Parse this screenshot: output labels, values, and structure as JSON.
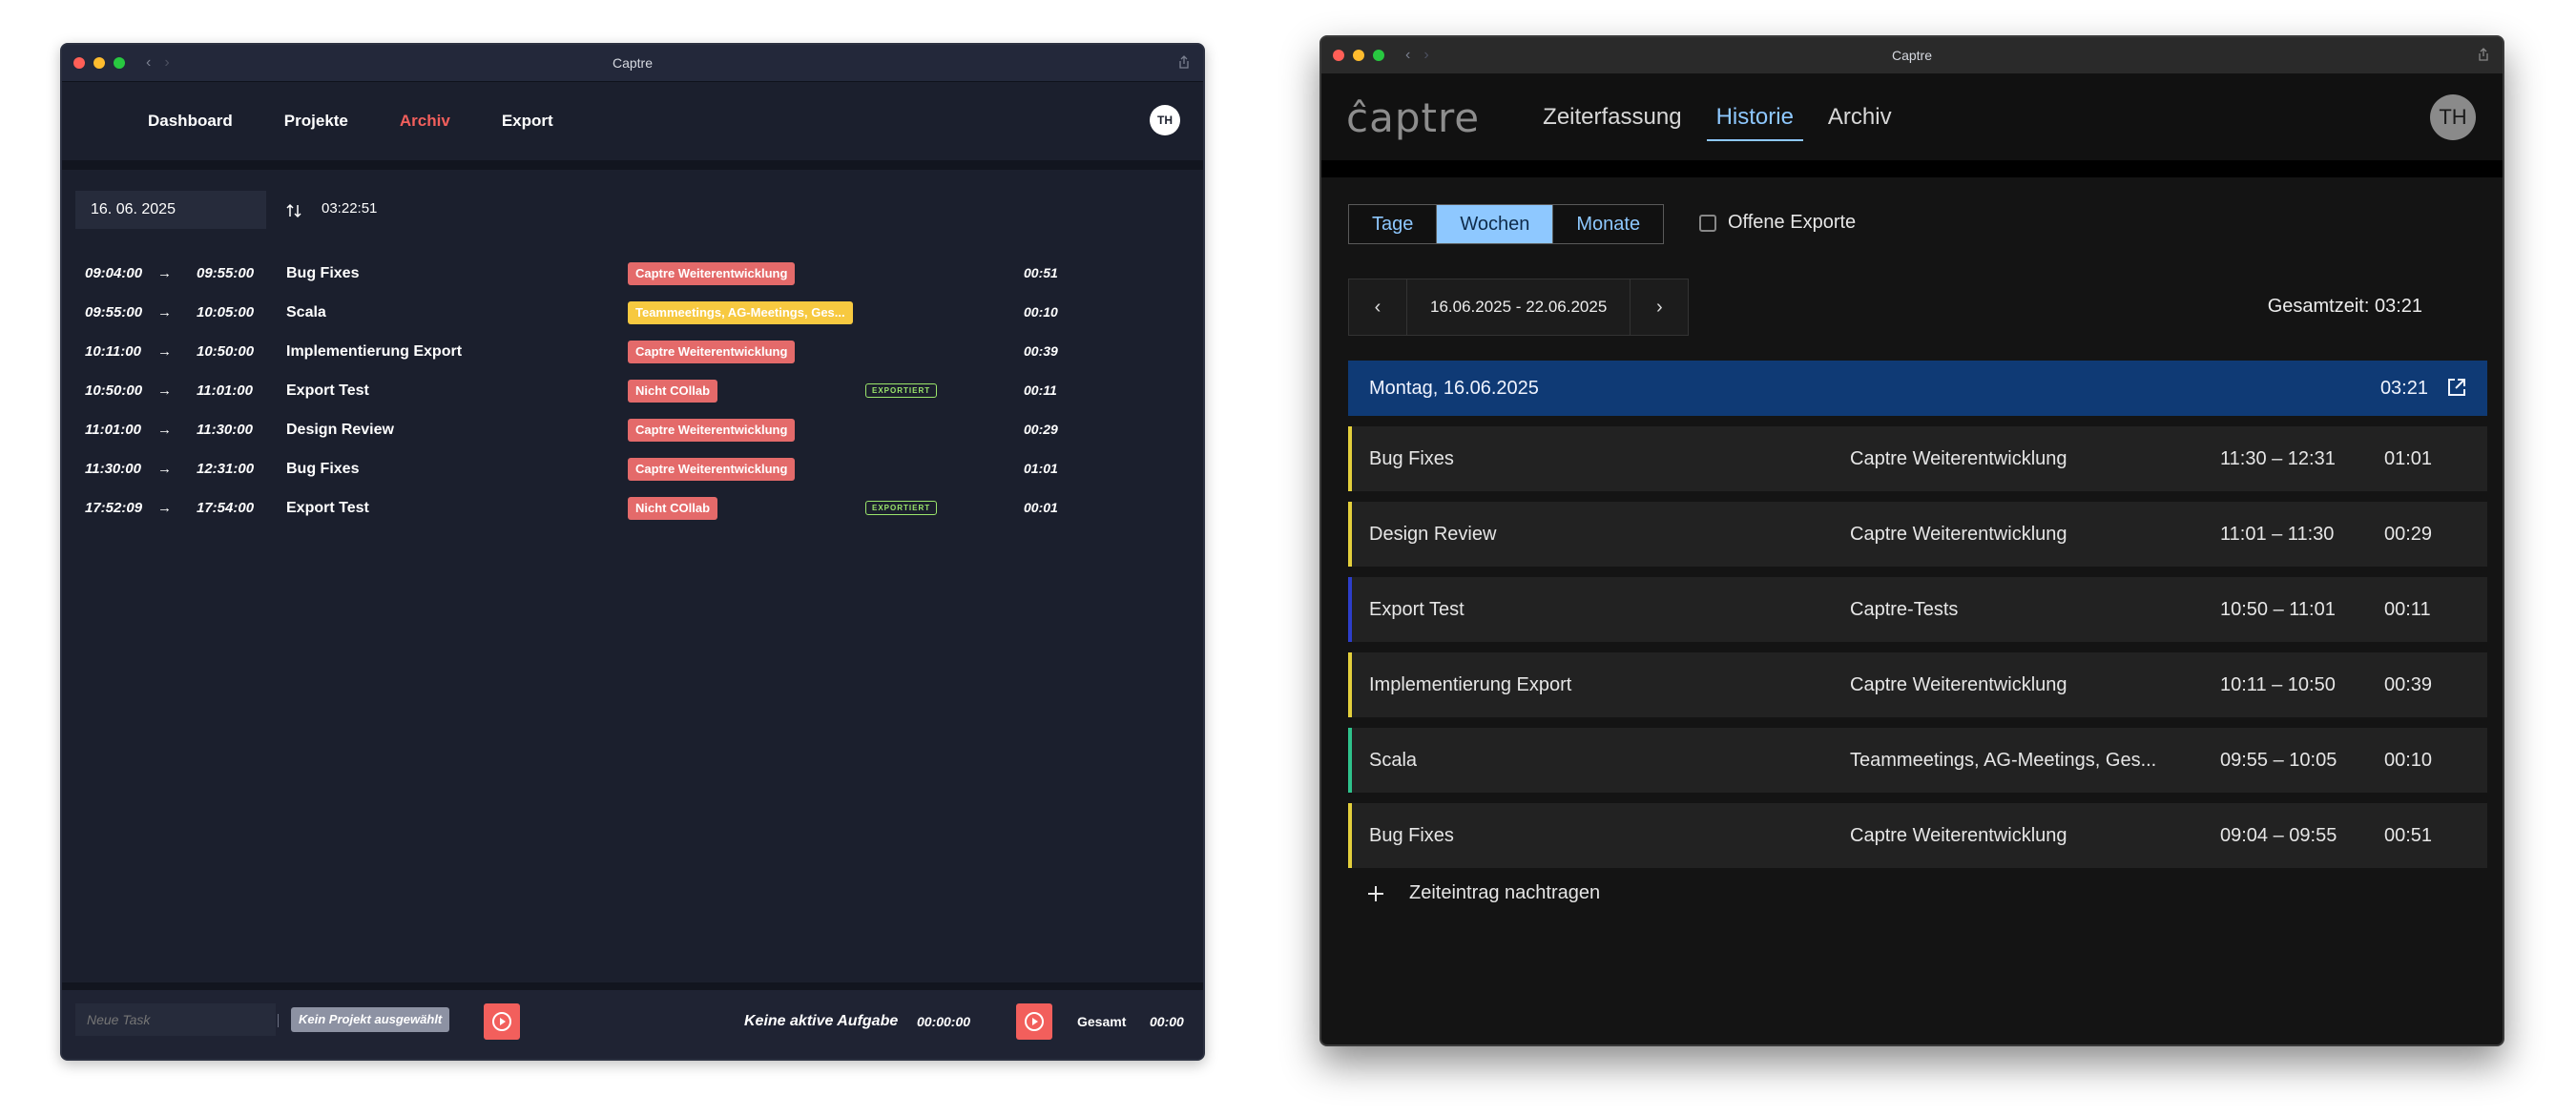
{
  "left_window": {
    "title": "Captre",
    "nav": {
      "items": [
        "Dashboard",
        "Projekte",
        "Archiv",
        "Export"
      ],
      "active": "Archiv"
    },
    "avatar": "TH",
    "date": "16. 06. 2025",
    "total": "03:22:51",
    "entries": [
      {
        "start": "09:04:00",
        "end": "09:55:00",
        "task": "Bug Fixes",
        "project": "Captre Weiterentwicklung",
        "tag_color": "red",
        "exported": "",
        "duration": "00:51"
      },
      {
        "start": "09:55:00",
        "end": "10:05:00",
        "task": "Scala",
        "project": "Teammeetings, AG-Meetings, Ges...",
        "tag_color": "yellow",
        "exported": "",
        "duration": "00:10"
      },
      {
        "start": "10:11:00",
        "end": "10:50:00",
        "task": "Implementierung Export",
        "project": "Captre Weiterentwicklung",
        "tag_color": "red",
        "exported": "",
        "duration": "00:39"
      },
      {
        "start": "10:50:00",
        "end": "11:01:00",
        "task": "Export Test",
        "project": "Nicht COllab",
        "tag_color": "red",
        "exported": "EXPORTIERT",
        "duration": "00:11"
      },
      {
        "start": "11:01:00",
        "end": "11:30:00",
        "task": "Design Review",
        "project": "Captre Weiterentwicklung",
        "tag_color": "red",
        "exported": "",
        "duration": "00:29"
      },
      {
        "start": "11:30:00",
        "end": "12:31:00",
        "task": "Bug Fixes",
        "project": "Captre Weiterentwicklung",
        "tag_color": "red",
        "exported": "",
        "duration": "01:01"
      },
      {
        "start": "17:52:09",
        "end": "17:54:00",
        "task": "Export Test",
        "project": "Nicht COllab",
        "tag_color": "red",
        "exported": "EXPORTIERT",
        "duration": "00:01"
      }
    ],
    "footer": {
      "task_placeholder": "Neue Task",
      "project_chip": "Kein Projekt ausgewählt",
      "active_task": "Keine aktive Aufgabe",
      "active_time": "00:00:00",
      "total_label": "Gesamt",
      "total_value": "00:00"
    }
  },
  "right_window": {
    "title": "Captre",
    "logo": "ĉaptre",
    "nav": {
      "items": [
        "Zeiterfassung",
        "Historie",
        "Archiv"
      ],
      "active": "Historie"
    },
    "avatar": "TH",
    "view_toggle": {
      "options": [
        "Tage",
        "Wochen",
        "Monate"
      ],
      "active": "Wochen"
    },
    "checkbox_label": "Offene Exporte",
    "range": "16.06.2025 - 22.06.2025",
    "total_time": "Gesamtzeit: 03:21",
    "day": {
      "label": "Montag, 16.06.2025",
      "total": "03:21"
    },
    "entries": [
      {
        "task": "Bug Fixes",
        "project": "Captre Weiterentwicklung",
        "time": "11:30  –  12:31",
        "duration": "01:01",
        "color": "#e3cf3c"
      },
      {
        "task": "Design Review",
        "project": "Captre Weiterentwicklung",
        "time": "11:01  –  11:30",
        "duration": "00:29",
        "color": "#e3cf3c"
      },
      {
        "task": "Export Test",
        "project": "Captre-Tests",
        "time": "10:50  –  11:01",
        "duration": "00:11",
        "color": "#2d3ec9"
      },
      {
        "task": "Implementierung Export",
        "project": "Captre Weiterentwicklung",
        "time": "10:11  –  10:50",
        "duration": "00:39",
        "color": "#e3cf3c"
      },
      {
        "task": "Scala",
        "project": "Teammeetings, AG-Meetings, Ges...",
        "time": "09:55  –  10:05",
        "duration": "00:10",
        "color": "#2fc28c"
      },
      {
        "task": "Bug Fixes",
        "project": "Captre Weiterentwicklung",
        "time": "09:04  –  09:55",
        "duration": "00:51",
        "color": "#e3cf3c"
      }
    ],
    "add_entry_label": "Zeiteintrag nachtragen"
  }
}
